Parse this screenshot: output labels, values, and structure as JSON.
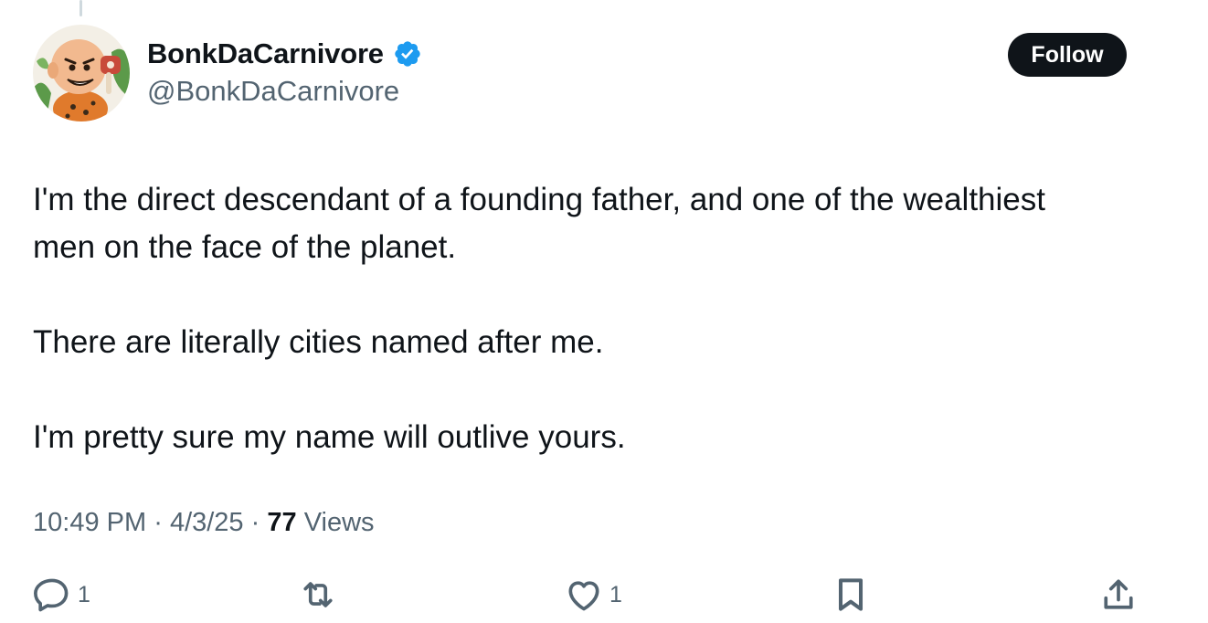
{
  "author": {
    "display_name": "BonkDaCarnivore",
    "handle": "@BonkDaCarnivore",
    "verified": true,
    "avatar_icon": "caveman-with-meat-avatar"
  },
  "follow_button": {
    "label": "Follow"
  },
  "tweet": {
    "paragraphs": [
      "I'm the direct descendant of a founding father, and one of the wealthiest men on the face of the planet.",
      "There are literally cities named after me.",
      "I'm pretty sure my name will outlive yours."
    ]
  },
  "meta": {
    "time": "10:49 PM",
    "date": "4/3/25",
    "separator": "·",
    "views_count": "77",
    "views_label": "Views"
  },
  "actions": {
    "reply": {
      "icon": "reply-icon",
      "count": "1"
    },
    "retweet": {
      "icon": "retweet-icon",
      "count": ""
    },
    "like": {
      "icon": "heart-icon",
      "count": "1"
    },
    "bookmark": {
      "icon": "bookmark-icon"
    },
    "share": {
      "icon": "share-icon"
    }
  },
  "colors": {
    "text_primary": "#0f1419",
    "text_secondary": "#536471",
    "verified_blue": "#1d9bf0",
    "follow_bg": "#0f1419",
    "follow_text": "#ffffff"
  }
}
